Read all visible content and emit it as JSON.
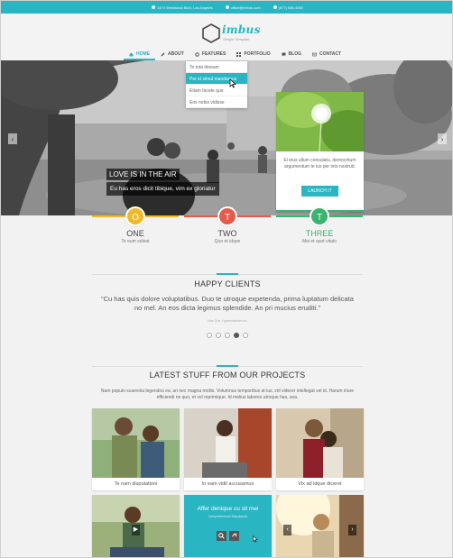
{
  "topbar": {
    "address": "1474 Westwood Blvd, Los Angeles",
    "email": "office@imbus.com",
    "phone": "(877) 556-4060"
  },
  "logo": {
    "name": "imbus",
    "tagline": "Simple Template"
  },
  "nav": [
    {
      "label": "HOME",
      "icon": "home-icon",
      "active": true
    },
    {
      "label": "ABOUT",
      "icon": "pencil-icon",
      "active": false
    },
    {
      "label": "FEATURES",
      "icon": "gear-icon",
      "active": false
    },
    {
      "label": "PORTFOLIO",
      "icon": "grid-icon",
      "active": false
    },
    {
      "label": "BLOG",
      "icon": "chat-icon",
      "active": false
    },
    {
      "label": "CONTACT",
      "icon": "envelope-icon",
      "active": false
    }
  ],
  "dropdown": [
    {
      "label": "Te tota timeam",
      "active": false
    },
    {
      "label": "Per id simul mandamus",
      "active": true
    },
    {
      "label": "Etiam facete quo",
      "active": false
    },
    {
      "label": "Eos nobis vidisse",
      "active": false
    }
  ],
  "hero": {
    "caption_title": "LOVE IS IN THE AIR",
    "caption_text": "Eu has eros dicit tibique, vim ex gloriatur",
    "promo_text": "Ei eius ullum consulatu, democritum argumentum te ius per into nostrud.",
    "promo_button": "LAUNCH IT",
    "arrow_left": "‹",
    "arrow_right": "›"
  },
  "features": [
    {
      "letter": "O",
      "title": "ONE",
      "subtitle": "Te eum soleat",
      "color": "#f0b92a"
    },
    {
      "letter": "T",
      "title": "TWO",
      "subtitle": "Quo et idque",
      "color": "#e55b4a"
    },
    {
      "letter": "T",
      "title": "THREE",
      "subtitle": "Mei et quot vitato",
      "color": "#39b36d"
    }
  ],
  "clients": {
    "title": "HAPPY CLIENTS",
    "quote": "“Cu has quis dolore voluptatibus. Duo te utroque expetenda, prima luptatum delicata no mel. An eos dicta legimus splendide. An pri mucius eruditi.”",
    "author": "John Doe, Hypermaketer Inc."
  },
  "projects": {
    "title": "LATEST STUFF FROM OUR PROJECTS",
    "intro": "Nam populo scaevola legendos ea, an nec magna mollis. Volumnus temporibus at ius, zril viderer intellegat vel id. Harum iriure efficiendi ne quo, et vel reprimique. Id melius labores utroque has, sea.",
    "items": [
      {
        "caption": "Te nam disputationi"
      },
      {
        "caption": "In eam vidit accusamus"
      },
      {
        "caption": "Vix ad idque diceret"
      },
      {
        "caption": ""
      },
      {
        "caption": ""
      },
      {
        "caption": ""
      }
    ],
    "hover_title": "Affer denique cu sit mei",
    "hover_subtitle": "Comprehensam Disputando"
  },
  "colors": {
    "accent": "#2ab5c3",
    "yellow": "#f0b92a",
    "red": "#e55b4a",
    "green": "#39b36d"
  }
}
